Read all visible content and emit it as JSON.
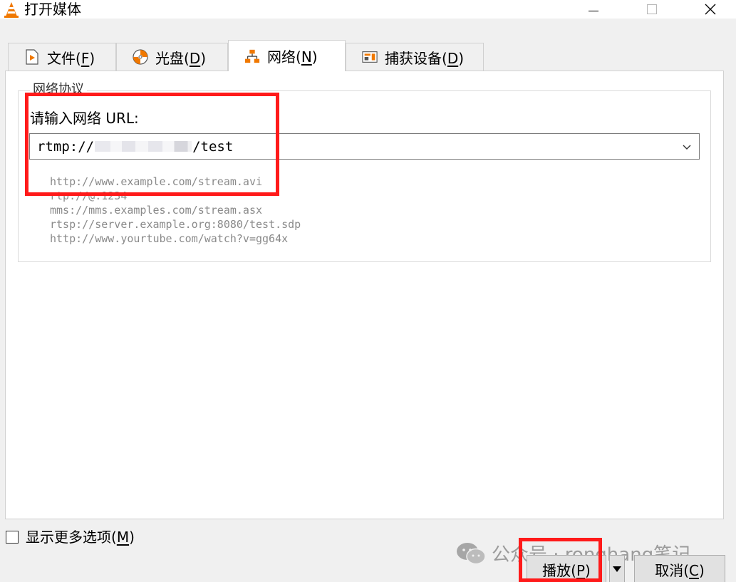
{
  "window": {
    "title": "打开媒体"
  },
  "tabs": [
    {
      "label": "文件(",
      "key": "F",
      "end": ")",
      "icon": "file-media-icon"
    },
    {
      "label": "光盘(",
      "key": "D",
      "end": ")",
      "icon": "disc-icon"
    },
    {
      "label": "网络(",
      "key": "N",
      "end": ")",
      "icon": "network-icon"
    },
    {
      "label": "捕获设备(",
      "key": "D",
      "end": ")",
      "icon": "capture-device-icon"
    }
  ],
  "active_tab": 2,
  "network": {
    "group_title": "网络协议",
    "url_label": "请输入网络 URL:",
    "url_value_prefix": "rtmp://",
    "url_value_suffix": "/test",
    "examples": [
      "http://www.example.com/stream.avi",
      "rtp://@:1234",
      "mms://mms.examples.com/stream.asx",
      "rtsp://server.example.org:8080/test.sdp",
      "http://www.yourtube.com/watch?v=gg64x"
    ]
  },
  "options": {
    "show_more_label": "显示更多选项(",
    "show_more_key": "M",
    "show_more_end": ")"
  },
  "buttons": {
    "play_label": "播放(",
    "play_key": "P",
    "play_end": ")",
    "cancel_label": "取消(",
    "cancel_key": "C",
    "cancel_end": ")"
  },
  "watermark": {
    "text": "公众号 · ronghang笔记"
  },
  "colors": {
    "highlight": "#ff1a1a",
    "accent_orange": "#f07800"
  }
}
